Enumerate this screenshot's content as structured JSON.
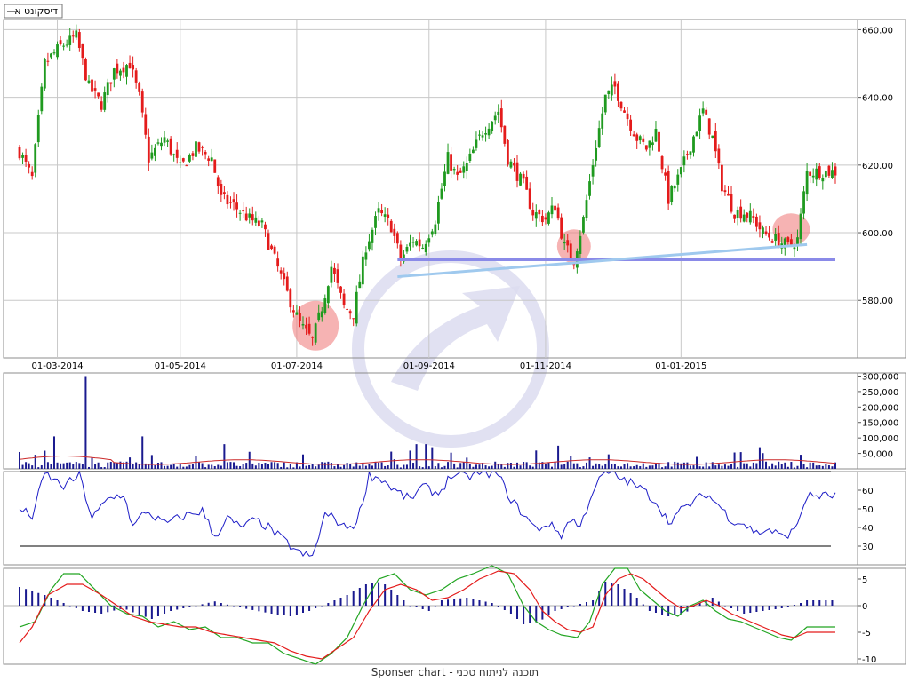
{
  "legend": {
    "label": "דיסקונט א"
  },
  "footer": {
    "text": "Sponser chart - תוכנה לניתוח טכני"
  },
  "colors": {
    "up": "#1f9a1f",
    "down": "#e41b1b",
    "volume": "#1a1a8f",
    "volume_ma": "#cc2a2a",
    "rsi": "#1d1dc7",
    "macd_line": "#e41b1b",
    "signal_line": "#22a522",
    "histogram": "#1a1a8f",
    "trendline": "#9fc9ee",
    "support": "#8a8ae8",
    "highlight": "#f08080",
    "grid": "#c8c8c8"
  },
  "icons": {
    "watermark": "arrow-up-right-circle-icon"
  },
  "chart_data": [
    {
      "id": "price",
      "type": "candlestick",
      "x_ticks": [
        "01-03-2014",
        "01-05-2014",
        "01-07-2014",
        "01-09-2014",
        "01-11-2014",
        "01-01-2015"
      ],
      "y_ticks": [
        "580.00",
        "600.00",
        "620.00",
        "640.00",
        "660.00"
      ],
      "ylim": [
        563,
        663
      ],
      "grid": true,
      "sessions": 260,
      "x_tick_sessions": [
        12,
        51,
        88,
        130,
        167,
        210
      ],
      "waypoints": [
        [
          0,
          624
        ],
        [
          4,
          616
        ],
        [
          8,
          650
        ],
        [
          13,
          655
        ],
        [
          18,
          658
        ],
        [
          22,
          643
        ],
        [
          26,
          638
        ],
        [
          30,
          648
        ],
        [
          35,
          650
        ],
        [
          38,
          640
        ],
        [
          41,
          622
        ],
        [
          46,
          628
        ],
        [
          51,
          619
        ],
        [
          56,
          625
        ],
        [
          61,
          622
        ],
        [
          64,
          610
        ],
        [
          68,
          608
        ],
        [
          73,
          604
        ],
        [
          77,
          602
        ],
        [
          81,
          592
        ],
        [
          85,
          582
        ],
        [
          89,
          573
        ],
        [
          93,
          568
        ],
        [
          96,
          578
        ],
        [
          99,
          590
        ],
        [
          103,
          578
        ],
        [
          106,
          576
        ],
        [
          110,
          596
        ],
        [
          114,
          606
        ],
        [
          118,
          602
        ],
        [
          121,
          592
        ],
        [
          125,
          598
        ],
        [
          128,
          596
        ],
        [
          132,
          604
        ],
        [
          136,
          622
        ],
        [
          139,
          616
        ],
        [
          142,
          620
        ],
        [
          147,
          630
        ],
        [
          152,
          636
        ],
        [
          155,
          622
        ],
        [
          160,
          614
        ],
        [
          163,
          606
        ],
        [
          167,
          604
        ],
        [
          170,
          608
        ],
        [
          173,
          596
        ],
        [
          176,
          592
        ],
        [
          179,
          604
        ],
        [
          183,
          626
        ],
        [
          186,
          640
        ],
        [
          189,
          643
        ],
        [
          192,
          636
        ],
        [
          196,
          628
        ],
        [
          199,
          625
        ],
        [
          202,
          630
        ],
        [
          206,
          610
        ],
        [
          210,
          618
        ],
        [
          213,
          626
        ],
        [
          217,
          636
        ],
        [
          220,
          628
        ],
        [
          223,
          614
        ],
        [
          227,
          606
        ],
        [
          230,
          606
        ],
        [
          233,
          604
        ],
        [
          236,
          600
        ],
        [
          240,
          598
        ],
        [
          244,
          596
        ],
        [
          247,
          598
        ],
        [
          250,
          618
        ]
      ],
      "trendline": {
        "from": [
          120,
          587
        ],
        "to": [
          250,
          596.5
        ]
      },
      "support": {
        "from": [
          120,
          592
        ],
        "to": [
          259,
          592
        ]
      },
      "highlights": [
        {
          "center": [
            94,
            572.5
          ],
          "rx": 26,
          "ry": 28
        },
        {
          "center": [
            176,
            596
          ],
          "rx": 19,
          "ry": 19
        },
        {
          "center": [
            245,
            601
          ],
          "rx": 21,
          "ry": 18
        }
      ]
    },
    {
      "id": "volume",
      "type": "bar",
      "y_ticks": [
        "50,000",
        "100,000",
        "150,000",
        "200,000",
        "250,000",
        "300,000"
      ],
      "ylim": [
        0,
        310000
      ],
      "spikes": [
        [
          21,
          300000
        ],
        [
          11,
          105000
        ],
        [
          39,
          105000
        ],
        [
          65,
          80000
        ],
        [
          126,
          80000
        ],
        [
          129,
          80000
        ],
        [
          131,
          70000
        ],
        [
          171,
          75000
        ],
        [
          235,
          70000
        ]
      ],
      "base_level": 15000,
      "ma_level": 22000
    },
    {
      "id": "rsi",
      "type": "line",
      "y_ticks": [
        "30",
        "40",
        "50",
        "60"
      ],
      "ylim": [
        20,
        70
      ],
      "guides": [
        30,
        70
      ],
      "waypoints": [
        [
          0,
          50
        ],
        [
          4,
          46
        ],
        [
          8,
          69
        ],
        [
          14,
          62
        ],
        [
          19,
          68
        ],
        [
          23,
          45
        ],
        [
          28,
          55
        ],
        [
          33,
          58
        ],
        [
          36,
          40
        ],
        [
          40,
          49
        ],
        [
          46,
          42
        ],
        [
          52,
          46
        ],
        [
          58,
          49
        ],
        [
          62,
          35
        ],
        [
          66,
          45
        ],
        [
          70,
          40
        ],
        [
          75,
          44
        ],
        [
          79,
          40
        ],
        [
          84,
          33
        ],
        [
          89,
          26
        ],
        [
          93,
          24
        ],
        [
          97,
          47
        ],
        [
          100,
          45
        ],
        [
          103,
          40
        ],
        [
          107,
          42
        ],
        [
          111,
          68
        ],
        [
          115,
          66
        ],
        [
          119,
          60
        ],
        [
          124,
          55
        ],
        [
          128,
          62
        ],
        [
          133,
          58
        ],
        [
          137,
          68
        ],
        [
          142,
          67
        ],
        [
          147,
          70
        ],
        [
          152,
          68
        ],
        [
          156,
          55
        ],
        [
          161,
          45
        ],
        [
          164,
          39
        ],
        [
          168,
          42
        ],
        [
          172,
          36
        ],
        [
          175,
          45
        ],
        [
          178,
          40
        ],
        [
          182,
          60
        ],
        [
          186,
          70
        ],
        [
          190,
          67
        ],
        [
          194,
          64
        ],
        [
          198,
          60
        ],
        [
          202,
          54
        ],
        [
          206,
          43
        ],
        [
          210,
          49
        ],
        [
          214,
          54
        ],
        [
          218,
          58
        ],
        [
          222,
          52
        ],
        [
          226,
          44
        ],
        [
          230,
          42
        ],
        [
          234,
          37
        ],
        [
          238,
          39
        ],
        [
          242,
          35
        ],
        [
          246,
          38
        ],
        [
          250,
          57
        ]
      ]
    },
    {
      "id": "macd",
      "type": "line+bar",
      "y_ticks": [
        "-10",
        "-5",
        "0",
        "5"
      ],
      "ylim": [
        -11,
        7
      ],
      "macd_waypoints": [
        [
          0,
          -7
        ],
        [
          4,
          -4
        ],
        [
          9,
          2
        ],
        [
          15,
          4
        ],
        [
          20,
          4
        ],
        [
          26,
          2
        ],
        [
          31,
          0
        ],
        [
          36,
          -2
        ],
        [
          41,
          -3
        ],
        [
          46,
          -3.5
        ],
        [
          51,
          -4
        ],
        [
          56,
          -4
        ],
        [
          61,
          -5
        ],
        [
          66,
          -5.5
        ],
        [
          71,
          -6
        ],
        [
          76,
          -6.5
        ],
        [
          81,
          -7
        ],
        [
          86,
          -8.5
        ],
        [
          91,
          -9.5
        ],
        [
          96,
          -10
        ],
        [
          101,
          -8
        ],
        [
          106,
          -6
        ],
        [
          111,
          -1
        ],
        [
          116,
          3
        ],
        [
          121,
          4
        ],
        [
          126,
          3
        ],
        [
          131,
          1
        ],
        [
          136,
          1.5
        ],
        [
          141,
          3
        ],
        [
          146,
          5
        ],
        [
          152,
          6.5
        ],
        [
          157,
          6
        ],
        [
          162,
          3
        ],
        [
          166,
          -1
        ],
        [
          170,
          -3
        ],
        [
          174,
          -4.5
        ],
        [
          178,
          -5
        ],
        [
          182,
          -4
        ],
        [
          186,
          2
        ],
        [
          190,
          5
        ],
        [
          194,
          6
        ],
        [
          198,
          5
        ],
        [
          202,
          3
        ],
        [
          206,
          1
        ],
        [
          210,
          -0.5
        ],
        [
          214,
          0
        ],
        [
          218,
          1
        ],
        [
          222,
          0
        ],
        [
          226,
          -1.5
        ],
        [
          230,
          -2.5
        ],
        [
          234,
          -3.5
        ],
        [
          238,
          -4.5
        ],
        [
          242,
          -5.5
        ],
        [
          246,
          -6
        ],
        [
          250,
          -5
        ]
      ],
      "signal_waypoints": [
        [
          0,
          -4
        ],
        [
          5,
          -3
        ],
        [
          10,
          3
        ],
        [
          14,
          6
        ],
        [
          19,
          6
        ],
        [
          24,
          3
        ],
        [
          29,
          0
        ],
        [
          34,
          -1.5
        ],
        [
          39,
          -2
        ],
        [
          44,
          -4
        ],
        [
          49,
          -3
        ],
        [
          54,
          -4.5
        ],
        [
          59,
          -4
        ],
        [
          64,
          -6
        ],
        [
          69,
          -6
        ],
        [
          74,
          -7
        ],
        [
          79,
          -7
        ],
        [
          84,
          -9
        ],
        [
          89,
          -10
        ],
        [
          94,
          -11
        ],
        [
          99,
          -9
        ],
        [
          104,
          -6
        ],
        [
          109,
          0
        ],
        [
          114,
          5
        ],
        [
          119,
          6
        ],
        [
          124,
          3
        ],
        [
          129,
          2
        ],
        [
          134,
          3
        ],
        [
          139,
          5
        ],
        [
          144,
          6
        ],
        [
          150,
          7.5
        ],
        [
          155,
          6
        ],
        [
          160,
          0
        ],
        [
          164,
          -3
        ],
        [
          168,
          -4.5
        ],
        [
          172,
          -5.5
        ],
        [
          177,
          -6
        ],
        [
          181,
          -3
        ],
        [
          185,
          4
        ],
        [
          189,
          7
        ],
        [
          193,
          7
        ],
        [
          197,
          3
        ],
        [
          201,
          1
        ],
        [
          205,
          -1
        ],
        [
          209,
          -2
        ],
        [
          213,
          0
        ],
        [
          217,
          1
        ],
        [
          221,
          -1
        ],
        [
          225,
          -2.5
        ],
        [
          229,
          -3
        ],
        [
          233,
          -4
        ],
        [
          237,
          -5
        ],
        [
          241,
          -6
        ],
        [
          245,
          -6.5
        ],
        [
          250,
          -4
        ]
      ],
      "histogram_waypoints": [
        [
          0,
          3.5
        ],
        [
          8,
          2
        ],
        [
          14,
          0.5
        ],
        [
          20,
          -1
        ],
        [
          26,
          -1.5
        ],
        [
          33,
          -0.5
        ],
        [
          37,
          -1.5
        ],
        [
          42,
          -2.5
        ],
        [
          48,
          -1
        ],
        [
          56,
          0
        ],
        [
          62,
          0.8
        ],
        [
          66,
          0.2
        ],
        [
          72,
          -0.6
        ],
        [
          80,
          -1.5
        ],
        [
          86,
          -2
        ],
        [
          92,
          -1
        ],
        [
          98,
          0.5
        ],
        [
          104,
          2
        ],
        [
          110,
          4
        ],
        [
          115,
          4.5
        ],
        [
          120,
          2
        ],
        [
          124,
          0
        ],
        [
          130,
          -1
        ],
        [
          134,
          1
        ],
        [
          142,
          1.5
        ],
        [
          150,
          0.5
        ],
        [
          156,
          -1.5
        ],
        [
          160,
          -3.5
        ],
        [
          165,
          -3
        ],
        [
          170,
          -1
        ],
        [
          176,
          0
        ],
        [
          182,
          1
        ],
        [
          186,
          4.5
        ],
        [
          190,
          4
        ],
        [
          196,
          1.5
        ],
        [
          200,
          -1
        ],
        [
          206,
          -2
        ],
        [
          211,
          -1.5
        ],
        [
          216,
          0.5
        ],
        [
          220,
          1.5
        ],
        [
          224,
          0
        ],
        [
          230,
          -1.5
        ],
        [
          236,
          -1
        ],
        [
          242,
          -0.5
        ],
        [
          248,
          0.5
        ],
        [
          250,
          1
        ]
      ]
    }
  ]
}
